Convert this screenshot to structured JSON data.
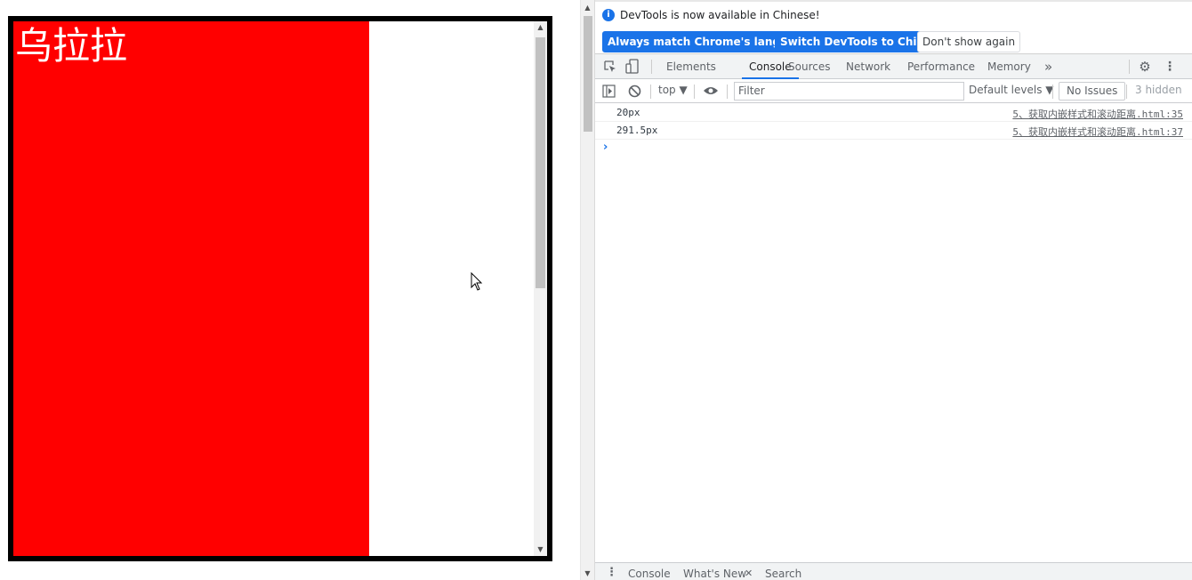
{
  "page": {
    "red_text": "乌拉拉"
  },
  "devtools": {
    "infobar": {
      "message": "DevTools is now available in Chinese!",
      "btn_match": "Always match Chrome's language",
      "btn_switch": "Switch DevTools to Chinese",
      "btn_dismiss": "Don't show again"
    },
    "tabs": [
      "Elements",
      "Console",
      "Sources",
      "Network",
      "Performance",
      "Memory"
    ],
    "active_tab": "Console",
    "more_tabs": "»",
    "toolbar": {
      "context": "top ▼",
      "filter_placeholder": "Filter",
      "levels": "Default levels ▼",
      "issues": "No Issues",
      "hidden": "3 hidden"
    },
    "console_logs": [
      {
        "value": "20px",
        "source": "5、获取内嵌样式和滚动距离.html:35"
      },
      {
        "value": "291.5px",
        "source": "5、获取内嵌样式和滚动距离.html:37"
      }
    ],
    "prompt": "›",
    "drawer": {
      "tabs": [
        "Console",
        "What's New",
        "Search"
      ],
      "close_mark": "✕"
    }
  },
  "icons": [
    "inspect-icon",
    "device-toggle-icon",
    "settings-icon",
    "kebab-menu-icon",
    "sidebar-toggle-icon",
    "clear-console-icon",
    "eye-icon",
    "info-icon",
    "cursor-icon"
  ],
  "colors": {
    "red_block": "#ff0000",
    "accent": "#1a73e8"
  }
}
